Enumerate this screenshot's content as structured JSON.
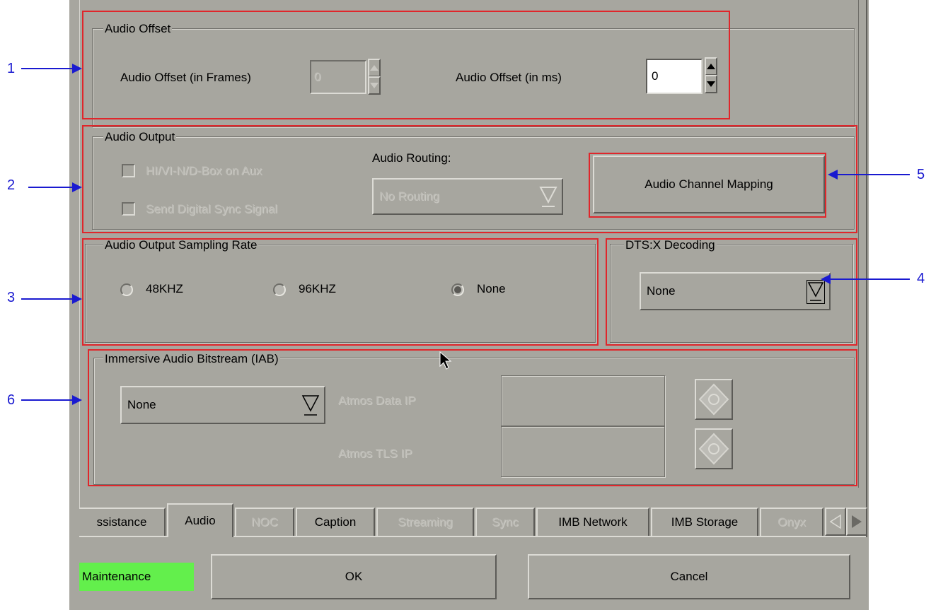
{
  "callouts": [
    "1",
    "2",
    "3",
    "4",
    "5",
    "6"
  ],
  "audio_offset": {
    "legend": "Audio Offset",
    "frames_label": "Audio Offset (in Frames)",
    "frames_value": "0",
    "ms_label": "Audio Offset (in ms)",
    "ms_value": "0"
  },
  "audio_output": {
    "legend": "Audio Output",
    "checkbox1_label": "HI/VI-N/D-Box on Aux",
    "checkbox2_label": "Send Digital Sync Signal",
    "routing_label": "Audio Routing:",
    "routing_value": "No Routing",
    "mapping_button": "Audio Channel Mapping"
  },
  "sampling_rate": {
    "legend": "Audio Output Sampling Rate",
    "options": [
      "48KHZ",
      "96KHZ",
      "None"
    ],
    "selected": "None"
  },
  "dtsx": {
    "legend": "DTS:X Decoding",
    "value": "None"
  },
  "iab": {
    "legend": "Immersive Audio Bitstream (IAB)",
    "value": "None",
    "data_ip_label": "Atmos Data IP",
    "tls_ip_label": "Atmos TLS IP",
    "data_ip_value": "",
    "tls_ip_value": ""
  },
  "tabs": [
    {
      "label": "ssistance",
      "enabled": true
    },
    {
      "label": "Audio",
      "enabled": true,
      "active": true
    },
    {
      "label": "NOC",
      "enabled": false
    },
    {
      "label": "Caption",
      "enabled": true
    },
    {
      "label": "Streaming",
      "enabled": false
    },
    {
      "label": "Sync",
      "enabled": false
    },
    {
      "label": "IMB Network",
      "enabled": true
    },
    {
      "label": "IMB Storage",
      "enabled": true
    },
    {
      "label": "Onyx",
      "enabled": false
    }
  ],
  "footer": {
    "status": "Maintenance",
    "status_color": "#63ef4c",
    "ok": "OK",
    "cancel": "Cancel"
  },
  "colors": {
    "panel": "#a7a69f",
    "highlight": "#e0262b",
    "annotation": "#1a1ad0"
  }
}
